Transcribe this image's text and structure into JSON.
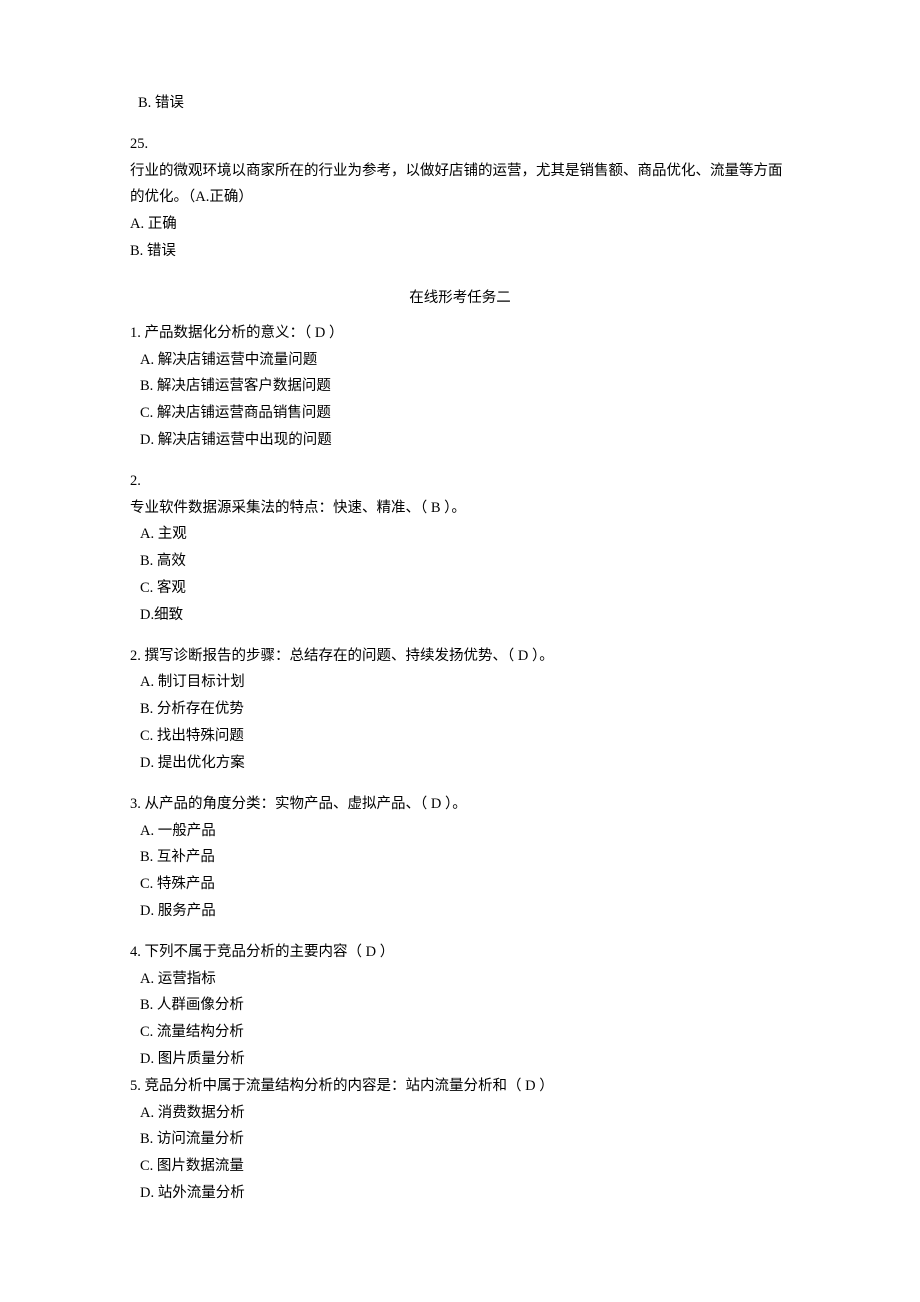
{
  "frag24": {
    "b": "B.  错误"
  },
  "q25": {
    "num": "25.",
    "stem": "行业的微观环境以商家所在的行业为参考，以做好店铺的运营，尤其是销售额、商品优化、流量等方面的优化。（A.正确）",
    "a": "A.  正确",
    "b": "B.  错误"
  },
  "section_title": "在线形考任务二",
  "s2": {
    "q1": {
      "stem": "1.  产品数据化分析的意义：（ D ）",
      "a": "A.  解决店铺运营中流量问题",
      "b": "B.  解决店铺运营客户数据问题",
      "c": "C.  解决店铺运营商品销售问题",
      "d": "D.  解决店铺运营中出现的问题"
    },
    "q2a": {
      "num": "2.",
      "stem": "专业软件数据源采集法的特点：快速、精准、（ B ）。",
      "a": "A.  主观",
      "b": "B.  高效",
      "c": "C.  客观",
      "d": "D.细致"
    },
    "q2b": {
      "stem": "2.  撰写诊断报告的步骤：总结存在的问题、持续发扬优势、（ D ）。",
      "a": "A.  制订目标计划",
      "b": "B.  分析存在优势",
      "c": "C.  找出特殊问题",
      "d": "D.  提出优化方案"
    },
    "q3": {
      "stem": "3.  从产品的角度分类：实物产品、虚拟产品、（ D ）。",
      "a": "A.  一般产品",
      "b": "B.  互补产品",
      "c": "C.  特殊产品",
      "d": "D.  服务产品"
    },
    "q4": {
      "stem": "4.  下列不属于竞品分析的主要内容（ D ）",
      "a": "A.  运营指标",
      "b": "B.  人群画像分析",
      "c": "C.  流量结构分析",
      "d": "D.  图片质量分析"
    },
    "q5": {
      "stem": "5.     竞品分析中属于流量结构分析的内容是：站内流量分析和（ D ）",
      "a": "A.  消费数据分析",
      "b": "B.  访问流量分析",
      "c": "C.  图片数据流量",
      "d": "D.  站外流量分析"
    }
  }
}
